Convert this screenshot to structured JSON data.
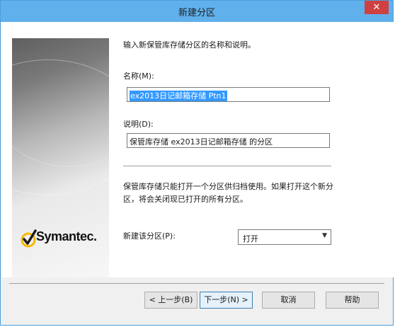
{
  "window": {
    "title": "新建分区",
    "close_glyph": "✕"
  },
  "banner": {
    "logo_text": "Symantec."
  },
  "form": {
    "prompt": "输入新保管库存储分区的名称和说明。",
    "name_label": "名称(M):",
    "name_value": "ex2013日记邮箱存储 Ptn1",
    "desc_label": "说明(D):",
    "desc_value": "保管库存储 ex2013日记邮箱存储 的分区",
    "note": "保管库存储只能打开一个分区供归档使用。如果打开这个新分区，将会关闭现已打开的所有分区。",
    "create_label": "新建该分区(P):",
    "create_value": "打开"
  },
  "buttons": {
    "back": "< 上一步(B)",
    "next": "下一步(N) >",
    "cancel": "取消",
    "help": "帮助"
  },
  "colors": {
    "titlebar": "#60b0ec",
    "close": "#cf4140",
    "selection": "#3399ff",
    "logo_check": "#f5b800"
  }
}
